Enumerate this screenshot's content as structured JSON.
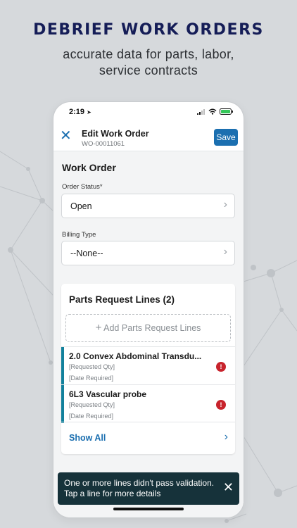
{
  "promo": {
    "headline": "DEBRIEF WORK ORDERS",
    "subline_1": "accurate data for parts, labor,",
    "subline_2": "service contracts"
  },
  "status_bar": {
    "time": "2:19",
    "time_icon": "location-arrow-icon"
  },
  "nav": {
    "close_icon": "close-icon",
    "title": "Edit Work Order",
    "subtitle": "WO-00011061",
    "save_label": "Save"
  },
  "work_order": {
    "section_title": "Work Order",
    "order_status_label": "Order Status*",
    "order_status_value": "Open",
    "billing_type_label": "Billing Type",
    "billing_type_value": "--None--"
  },
  "parts_request": {
    "title": "Parts Request Lines (2)",
    "add_label": "Add Parts Request Lines",
    "lines": [
      {
        "name": "2.0 Convex Abdominal Transdu...",
        "qty": "[Requested Qty]",
        "date": "[Date Required]",
        "error": "!"
      },
      {
        "name": "6L3 Vascular probe",
        "qty": "[Requested Qty]",
        "date": "[Date Required]",
        "error": "!"
      }
    ],
    "show_all_label": "Show All"
  },
  "toast": {
    "message": "One or more lines didn't pass validation. Tap a line for more details",
    "close_icon": "close-icon"
  },
  "colors": {
    "accent": "#1b6fb0",
    "headline": "#151d57",
    "line_accent": "#12819c",
    "error": "#c8232c",
    "toast_bg": "#16323a"
  }
}
